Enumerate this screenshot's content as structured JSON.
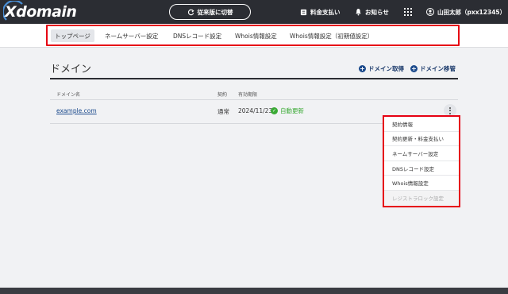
{
  "header": {
    "logo_text": "Xdomain",
    "switch_label": "従来版に切替",
    "payment_label": "料金支払い",
    "notice_label": "お知らせ",
    "user_label": "山田太郎（pxx12345）"
  },
  "subnav": {
    "tabs": [
      {
        "label": "トップページ",
        "active": true
      },
      {
        "label": "ネームサーバー設定"
      },
      {
        "label": "DNSレコード設定"
      },
      {
        "label": "Whois情報設定"
      },
      {
        "label": "Whois情報設定（初期値設定）"
      }
    ]
  },
  "main": {
    "title": "ドメイン",
    "actions": {
      "acquire": "ドメイン取得",
      "transfer": "ドメイン移管"
    },
    "table": {
      "columns": [
        "ドメイン名",
        "契約",
        "有効期限"
      ],
      "rows": [
        {
          "domain": "example.com",
          "contract": "通常",
          "expiry": "2024/11/23",
          "auto_renew": "自動更新"
        }
      ]
    }
  },
  "row_menu": {
    "items": [
      {
        "label": "契約情報"
      },
      {
        "label": "契約更新・料金支払い"
      },
      {
        "label": "ネームサーバー設定"
      },
      {
        "label": "DNSレコード設定"
      },
      {
        "label": "Whois情報設定"
      },
      {
        "label": "レジストラロック設定",
        "disabled": true
      }
    ]
  },
  "colors": {
    "topbar": "#2b2d33",
    "highlight": "#e60012",
    "link": "#1b4a8c",
    "success": "#3aaa35"
  }
}
